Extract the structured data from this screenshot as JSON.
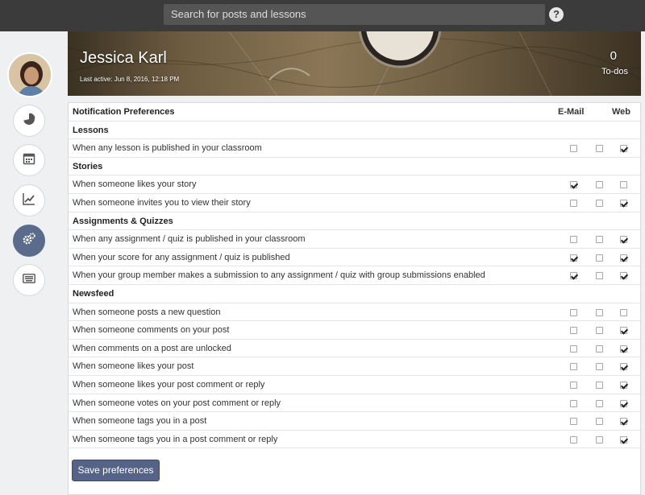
{
  "search": {
    "placeholder": "Search for posts and lessons"
  },
  "profile": {
    "name": "Jessica Karl",
    "last_active": "Last active: Jun 8, 2016, 12:18 PM",
    "todo_count": "0",
    "todo_label": "To-dos"
  },
  "sidebar": {
    "items": [
      {
        "icon": "pie-chart-icon"
      },
      {
        "icon": "calendar-icon"
      },
      {
        "icon": "trend-chart-icon"
      },
      {
        "icon": "gears-icon",
        "active": true
      },
      {
        "icon": "keyboard-icon"
      }
    ]
  },
  "prefs": {
    "header": "Notification Preferences",
    "col_email": "E-Mail",
    "col_web": "Web",
    "rows": [
      {
        "type": "section",
        "label": "Lessons"
      },
      {
        "type": "item",
        "label": "When any lesson is published in your classroom",
        "c1": false,
        "c2": false,
        "c3": true
      },
      {
        "type": "section",
        "label": "Stories"
      },
      {
        "type": "item",
        "label": "When someone likes your story",
        "c1": true,
        "c2": false,
        "c3": false
      },
      {
        "type": "item",
        "label": "When someone invites you to view their story",
        "c1": false,
        "c2": false,
        "c3": true
      },
      {
        "type": "section",
        "label": "Assignments & Quizzes"
      },
      {
        "type": "item",
        "label": "When any assignment / quiz is published in your classroom",
        "c1": false,
        "c2": false,
        "c3": true
      },
      {
        "type": "item",
        "label": "When your score for any assignment / quiz is published",
        "c1": true,
        "c2": false,
        "c3": true
      },
      {
        "type": "item",
        "label": "When your group member makes a submission to any assignment / quiz with group submissions enabled",
        "c1": true,
        "c2": false,
        "c3": true
      },
      {
        "type": "section",
        "label": "Newsfeed"
      },
      {
        "type": "item",
        "label": "When someone posts a new question",
        "c1": false,
        "c2": false,
        "c3": false
      },
      {
        "type": "item",
        "label": "When someone comments on your post",
        "c1": false,
        "c2": false,
        "c3": true
      },
      {
        "type": "item",
        "label": "When comments on a post are unlocked",
        "c1": false,
        "c2": false,
        "c3": true
      },
      {
        "type": "item",
        "label": "When someone likes your post",
        "c1": false,
        "c2": false,
        "c3": true
      },
      {
        "type": "item",
        "label": "When someone likes your post comment or reply",
        "c1": false,
        "c2": false,
        "c3": true
      },
      {
        "type": "item",
        "label": "When someone votes on your post comment or reply",
        "c1": false,
        "c2": false,
        "c3": true
      },
      {
        "type": "item",
        "label": "When someone tags you in a post",
        "c1": false,
        "c2": false,
        "c3": true
      },
      {
        "type": "item",
        "label": "When someone tags you in a post comment or reply",
        "c1": false,
        "c2": false,
        "c3": true
      }
    ],
    "save_label": "Save preferences"
  },
  "colors": {
    "topbar": "#3b3b3b",
    "accent": "#556486",
    "active_nav": "#5a6b8c"
  }
}
